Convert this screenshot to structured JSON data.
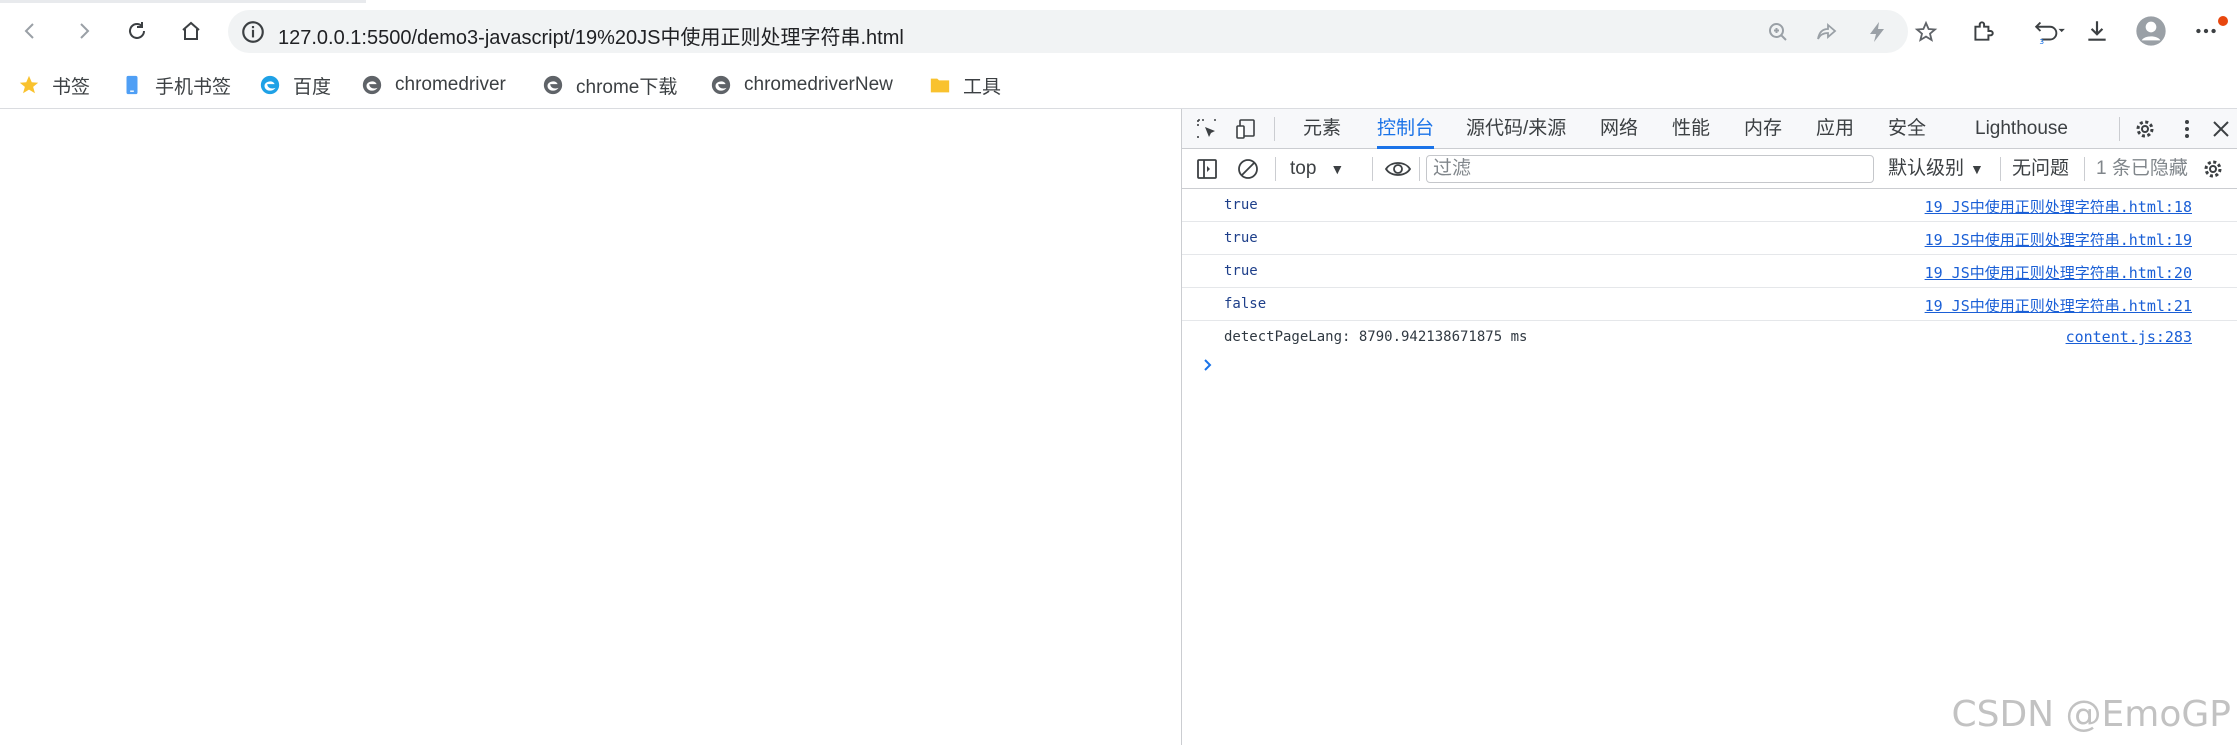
{
  "browser": {
    "url": "127.0.0.1:5500/demo3-javascript/19%20JS中使用正则处理字符串.html",
    "nav_icons": [
      "back-icon",
      "forward-icon",
      "reload-icon",
      "home-icon"
    ],
    "toolbar_icons": [
      "zoom-icon",
      "share-icon",
      "lightning-icon",
      "star-icon",
      "extensions-icon",
      "history-icon",
      "download-icon",
      "profile-icon",
      "more-icon"
    ]
  },
  "bookmarks": [
    {
      "label": "书签",
      "icon": "star-icon"
    },
    {
      "label": "手机书签",
      "icon": "phone-icon"
    },
    {
      "label": "百度",
      "icon": "edge-icon"
    },
    {
      "label": "chromedriver",
      "icon": "globe-icon"
    },
    {
      "label": "chrome下载",
      "icon": "globe-icon"
    },
    {
      "label": "chromedriverNew",
      "icon": "globe-icon"
    },
    {
      "label": "工具",
      "icon": "folder-icon"
    }
  ],
  "devtools": {
    "tabs": [
      "元素",
      "控制台",
      "源代码/来源",
      "网络",
      "性能",
      "内存",
      "应用",
      "安全",
      "Lighthouse"
    ],
    "active_tab": "控制台",
    "toolbar": {
      "context": "top",
      "filter_placeholder": "过滤",
      "levels": "默认级别",
      "issues": "无问题",
      "hidden": "1 条已隐藏"
    },
    "console": [
      {
        "message": "true",
        "source": "19 JS中使用正则处理字符串.html:18"
      },
      {
        "message": "true",
        "source": "19 JS中使用正则处理字符串.html:19"
      },
      {
        "message": "true",
        "source": "19 JS中使用正则处理字符串.html:20"
      },
      {
        "message": "false",
        "source": "19 JS中使用正则处理字符串.html:21"
      },
      {
        "message": "detectPageLang: 8790.942138671875 ms",
        "source": "content.js:283"
      }
    ]
  },
  "watermark": "CSDN @EmoGP",
  "colors": {
    "accent": "#1a73e8",
    "link": "#1a5fd6",
    "notify": "#e8470e"
  }
}
